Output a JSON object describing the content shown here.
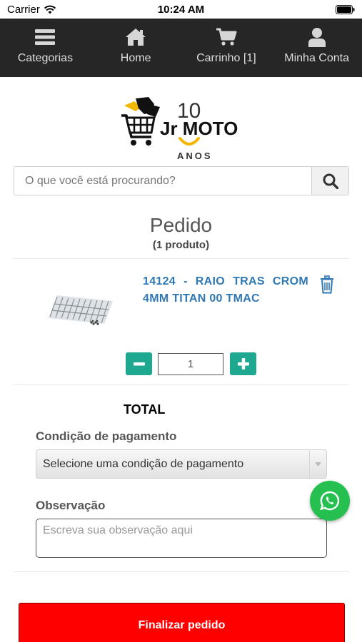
{
  "status_bar": {
    "carrier": "Carrier",
    "time": "10:24 AM",
    "icons": [
      "wifi-icon",
      "battery-icon"
    ]
  },
  "nav": {
    "items": [
      {
        "label": "Categorias",
        "icon": "menu-icon"
      },
      {
        "label": "Home",
        "icon": "home-icon"
      },
      {
        "label": "Carrinho [1]",
        "icon": "cart-icon"
      },
      {
        "label": "Minha Conta",
        "icon": "user-icon"
      }
    ]
  },
  "logo": {
    "number": "10",
    "brand": "Jr MOTO",
    "subtitle": "ANOS",
    "accent_color": "#f2b705"
  },
  "search": {
    "placeholder": "O que você está procurando?",
    "value": "",
    "icon": "search-icon"
  },
  "order": {
    "title": "Pedido",
    "count": "(1 produto)"
  },
  "product": {
    "name": "14124 - RAIO TRAS CROM 4MM TITAN 00 TMAC",
    "quantity": "1",
    "icons": [
      "trash-icon",
      "minus-icon",
      "plus-icon"
    ]
  },
  "totals": {
    "label": "TOTAL"
  },
  "payment": {
    "label": "Condição de pagamento",
    "selected": "Selecione uma condição de pagamento"
  },
  "observation": {
    "label": "Observação",
    "placeholder": "Escreva sua observação aqui",
    "value": ""
  },
  "whatsapp": {
    "icon": "whatsapp-icon",
    "color": "#25c04f"
  },
  "finalize": {
    "label": "Finalizar pedido",
    "color": "#ff0000"
  },
  "colors": {
    "nav_bg": "#262626",
    "link": "#2f78b4",
    "stepper": "#1fa890"
  }
}
